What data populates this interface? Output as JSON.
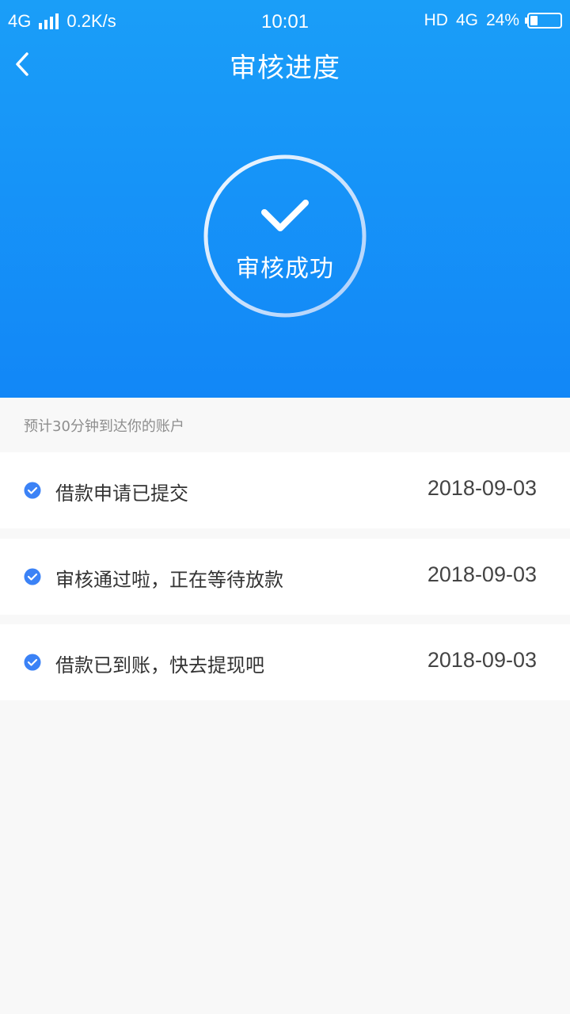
{
  "status_bar": {
    "network": "4G",
    "speed": "0.2K/s",
    "time": "10:01",
    "hd": "HD",
    "network_right": "4G",
    "battery": "24%",
    "battery_level": 0.24
  },
  "nav": {
    "title": "审核进度"
  },
  "progress": {
    "status_text": "审核成功"
  },
  "hint": "预计30分钟到达你的账户",
  "timeline": [
    {
      "label": "借款申请已提交",
      "date": "2018-09-03"
    },
    {
      "label": "审核通过啦，正在等待放款",
      "date": "2018-09-03"
    },
    {
      "label": "借款已到账，快去提现吧",
      "date": "2018-09-03"
    }
  ],
  "colors": {
    "primary": "#1287f7",
    "check": "#3b82f6",
    "hint": "#8e8e8e"
  }
}
